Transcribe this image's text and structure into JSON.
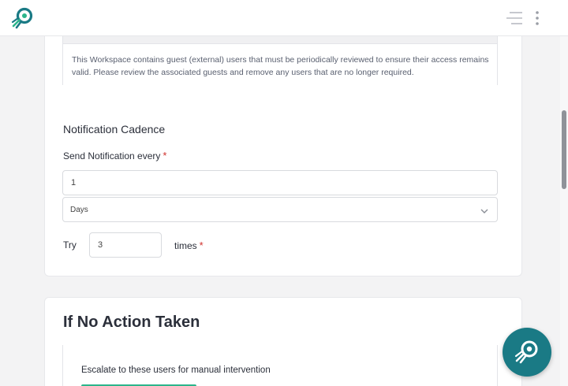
{
  "header": {
    "logo_icon": "rocket-logo-icon",
    "menu_icon": "menu-icon",
    "more_icon": "kebab-icon"
  },
  "notice": {
    "text": "This Workspace contains guest (external) users that must be periodically reviewed to ensure their access remains valid. Please review the associated guests and remove any users that are no longer required."
  },
  "notification_cadence": {
    "title": "Notification Cadence",
    "send_label": "Send Notification every",
    "required_mark": "*",
    "interval_value": "1",
    "unit_selected": "Days",
    "try_label": "Try",
    "try_value": "3",
    "times_label": "times"
  },
  "no_action": {
    "title": "If No Action Taken",
    "escalate_label": "Escalate to these users for manual intervention"
  },
  "colors": {
    "brand": "#1a7a85",
    "accent": "#2bb58a",
    "required": "#d0312d"
  }
}
